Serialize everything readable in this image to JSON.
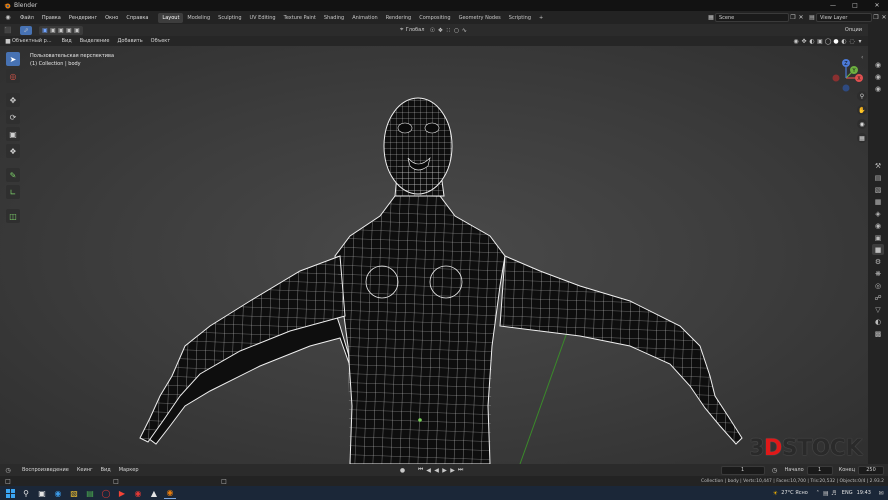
{
  "window": {
    "title": "Blender"
  },
  "menu": [
    "Файл",
    "Правка",
    "Рендеринг",
    "Окно",
    "Справка"
  ],
  "workspaces": {
    "tabs": [
      "Layout",
      "Modeling",
      "Sculpting",
      "UV Editing",
      "Texture Paint",
      "Shading",
      "Animation",
      "Rendering",
      "Compositing",
      "Geometry Nodes",
      "Scripting"
    ],
    "active": "Layout",
    "add": "+"
  },
  "scene": {
    "scene_name": "Scene",
    "view_layer": "View Layer"
  },
  "tool_header": {
    "orientation": "Глобал",
    "options": "Опции"
  },
  "view_header": {
    "mode": "Объектный р...",
    "items": [
      "Вид",
      "Выделение",
      "Добавить",
      "Объект"
    ]
  },
  "viewport": {
    "perspective": "Пользовательская перспектива",
    "collection": "(1) Collection | body",
    "gizmo": {
      "x": "X",
      "y": "Y",
      "z": "Z"
    }
  },
  "timeline": {
    "items": [
      "Воспроизведение",
      "Кеинг",
      "Вид",
      "Маркер"
    ],
    "current_frame": "1",
    "start_label": "Начало",
    "start": "1",
    "end_label": "Конец",
    "end": "250"
  },
  "status": {
    "text": "Collection | body | Verts:10,447 | Faces:10,700 | Tris:20,532 | Objects:0/4 | 2.93.2"
  },
  "taskbar": {
    "weather": "27°C Ясно",
    "lang": "ENG",
    "time": "19:43"
  },
  "watermark": {
    "prefix": "3",
    "d": "D",
    "rest": "STOCK"
  },
  "colors": {
    "accent": "#4772b3",
    "active_tab": "#3d3d3d",
    "taskbar": "#1b2738"
  }
}
